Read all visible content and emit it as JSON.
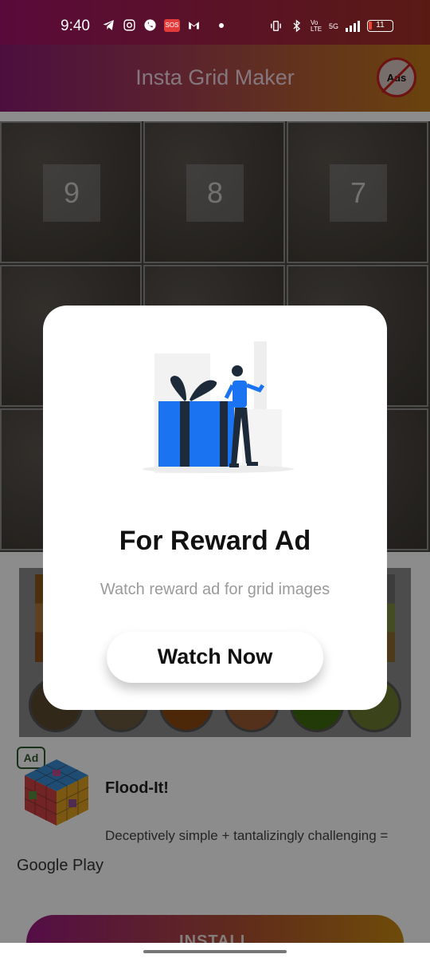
{
  "status_bar": {
    "time": "9:40",
    "sos_label": "SOS",
    "network": "5G",
    "volte": "Vo LTE",
    "battery": "11"
  },
  "app_bar": {
    "title": "Insta Grid Maker",
    "no_ads_label": "Ads"
  },
  "grid": {
    "cells": [
      "9",
      "8",
      "7"
    ]
  },
  "palette": {
    "swatch_colors": [
      "#8a5a20",
      "#a87840",
      "#6e6e6e"
    ],
    "circle_colors": [
      "#5a4a30",
      "#6a5a40",
      "#8a4a10",
      "#9a5a30",
      "#3f6a10",
      "#6a7a30"
    ]
  },
  "ad": {
    "badge": "Ad",
    "title": "Flood-It!",
    "description": "Deceptively simple + tantalizingly challenging =",
    "source": "Google Play",
    "install_label": "INSTALL"
  },
  "dialog": {
    "title": "For Reward Ad",
    "subtitle": "Watch reward ad for grid images",
    "button_label": "Watch Now",
    "illustration": "gift-box-with-person-icon"
  }
}
